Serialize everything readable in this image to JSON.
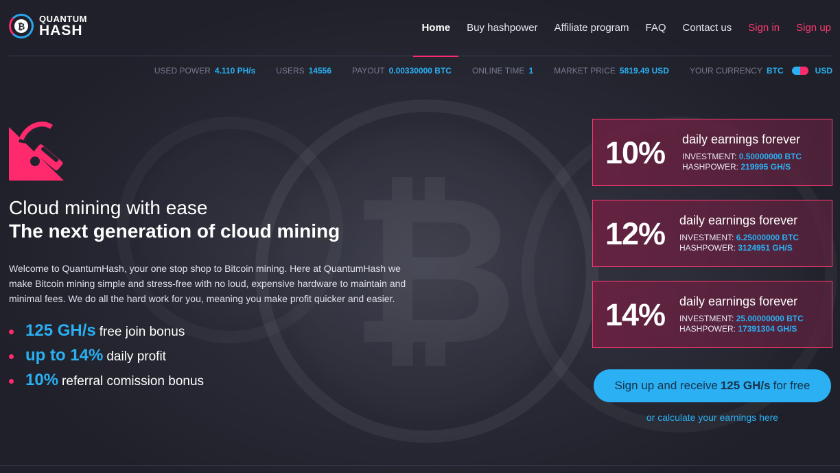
{
  "brand": {
    "line1": "QUANTUM",
    "line2": "HASH"
  },
  "nav": [
    {
      "label": "Home",
      "active": true
    },
    {
      "label": "Buy hashpower"
    },
    {
      "label": "Affiliate program"
    },
    {
      "label": "FAQ"
    },
    {
      "label": "Contact us"
    },
    {
      "label": "Sign in"
    },
    {
      "label": "Sign up"
    }
  ],
  "stats": {
    "used_power": {
      "label": "USED POWER",
      "value": "4.110 PH/s"
    },
    "users": {
      "label": "USERS",
      "value": "14556"
    },
    "payout": {
      "label": "PAYOUT",
      "value": "0.00330000 BTC"
    },
    "online_time": {
      "label": "ONLINE TIME",
      "value": "1"
    },
    "market_price": {
      "label": "MARKET PRICE",
      "value": "5819.49 USD"
    },
    "currency": {
      "label": "YOUR CURRENCY",
      "left": "BTC",
      "right": "USD"
    }
  },
  "hero": {
    "title1": "Cloud mining with ease",
    "title2": "The next generation of cloud mining",
    "intro": "Welcome to QuantumHash, your one stop shop to Bitcoin mining. Here at QuantumHash we make Bitcoin mining simple and stress-free with no loud, expensive hardware to maintain and minimal fees. We do all the hard work for you, meaning you make profit quicker and easier.",
    "features": [
      {
        "highlight": "125 GH/s",
        "text": "free join bonus"
      },
      {
        "highlight": "up to 14%",
        "text": "daily profit"
      },
      {
        "highlight": "10%",
        "text": "referral comission bonus"
      }
    ]
  },
  "plans": [
    {
      "pct": "10%",
      "title": "daily earnings forever",
      "inv_label": "INVESTMENT:",
      "inv": "0.50000000 BTC",
      "hp_label": "HASHPOWER:",
      "hp": "219995 GH/S"
    },
    {
      "pct": "12%",
      "title": "daily earnings forever",
      "inv_label": "INVESTMENT:",
      "inv": "6.25000000 BTC",
      "hp_label": "HASHPOWER:",
      "hp": "3124951 GH/S"
    },
    {
      "pct": "14%",
      "title": "daily earnings forever",
      "inv_label": "INVESTMENT:",
      "inv": "25.00000000 BTC",
      "hp_label": "HASHPOWER:",
      "hp": "17391304 GH/S"
    }
  ],
  "cta": {
    "pre": "Sign up and receive",
    "bold": "125 GH/s",
    "post": "for free"
  },
  "calc_link": "or calculate your earnings here",
  "colors": {
    "accent_blue": "#2ab0f3",
    "accent_pink": "#ff2a6d",
    "bg": "#22232e"
  },
  "icons": {
    "logo": "bitcoin-coin-icon",
    "hero": "pickaxe-icon",
    "list": "bullet-dot-icon"
  }
}
